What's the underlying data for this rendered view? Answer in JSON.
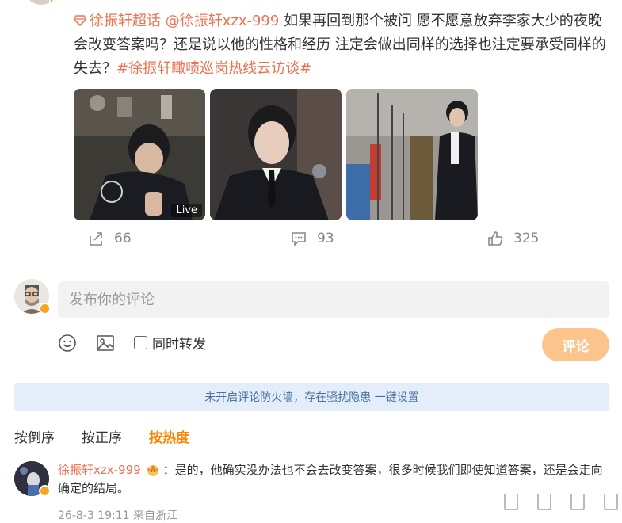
{
  "post": {
    "topic": "徐振轩超话",
    "mention": "@徐振轩xzx-999",
    "text": " 如果再回到那个被问 愿不愿意放弃李家大少的夜晚 会改变答案吗？还是说以他的性格和经历 注定会做出同样的选择也注定要承受同样的失去？",
    "hashtag": "#徐振轩瞰啧巡岗热线云访谈#",
    "images": [
      {
        "live_label": "Live"
      },
      {},
      {}
    ]
  },
  "actions": {
    "forward_count": "66",
    "comment_count": "93",
    "like_count": "325"
  },
  "composer": {
    "placeholder": "发布你的评论",
    "forward_label": "同时转发",
    "submit_label": "评论"
  },
  "firewall_notice": "未开启评论防火墙，存在骚扰隐患 一键设置",
  "sort": {
    "tabs": [
      "按倒序",
      "按正序",
      "按热度"
    ],
    "active": "按热度"
  },
  "comment": {
    "user": "徐振轩xzx-999",
    "text": "：是的，他确实没办法也不会去改变答案，很多时候我们即使知道答案，还是会走向确定的结局。",
    "meta": "26-8-3 19:11 来自浙江"
  },
  "colors": {
    "accent": "#eb7350",
    "active_sort": "#ff8200",
    "submit_bg": "#fbc48d",
    "firewall_bg": "#e3eefa"
  }
}
